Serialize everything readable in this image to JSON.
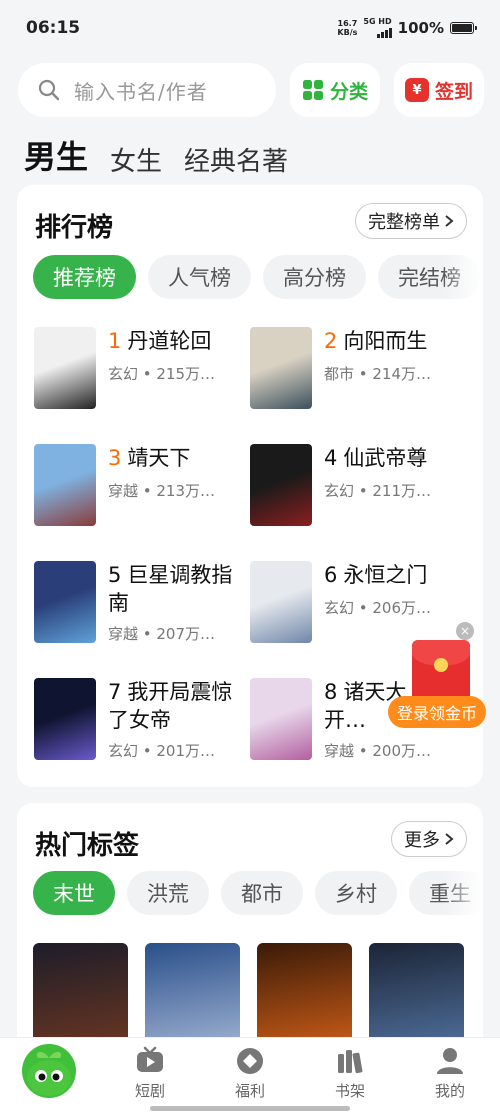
{
  "status_bar": {
    "time": "06:15",
    "net_speed": "16.7",
    "net_unit": "KB/s",
    "signal": "5G HD",
    "battery": "100%",
    "battery_level": 1.0
  },
  "search": {
    "placeholder": "输入书名/作者"
  },
  "header_buttons": {
    "category": "分类",
    "sign_in": "签到",
    "sign_icon": "¥"
  },
  "tabs": [
    {
      "label": "男生",
      "active": true
    },
    {
      "label": "女生"
    },
    {
      "label": "经典名著"
    }
  ],
  "ranking": {
    "title": "排行榜",
    "full_list": "完整榜单",
    "chips": [
      {
        "label": "推荐榜",
        "active": true
      },
      {
        "label": "人气榜"
      },
      {
        "label": "高分榜"
      },
      {
        "label": "完结榜"
      }
    ],
    "books": [
      {
        "num": "1",
        "title": "丹道轮回",
        "meta": "玄幻 • 215万…",
        "colors": [
          "#f0f0f0",
          "#222222"
        ]
      },
      {
        "num": "2",
        "title": "向阳而生",
        "meta": "都市 • 214万…",
        "colors": [
          "#d9d2c3",
          "#3b4f5c"
        ]
      },
      {
        "num": "3",
        "title": "靖天下",
        "meta": "穿越 • 213万…",
        "colors": [
          "#7fb2e0",
          "#8a3b3b"
        ]
      },
      {
        "num": "4",
        "title": "仙武帝尊",
        "meta": "玄幻 • 211万…",
        "colors": [
          "#1a1a1a",
          "#8b1f1f"
        ]
      },
      {
        "num": "5",
        "title": "巨星调教指南",
        "meta": "穿越 • 207万…",
        "colors": [
          "#2a3f7a",
          "#5fa3d9"
        ]
      },
      {
        "num": "6",
        "title": "永恒之门",
        "meta": "玄幻 • 206万…",
        "colors": [
          "#e6e9ee",
          "#6f86a8"
        ]
      },
      {
        "num": "7",
        "title": "我开局震惊了女帝",
        "meta": "玄幻 • 201万…",
        "colors": [
          "#0f1430",
          "#6a5acd"
        ]
      },
      {
        "num": "8",
        "title": "诸天大…之开…",
        "meta": "穿越 • 200万…",
        "colors": [
          "#e8d7ea",
          "#b25fa0"
        ]
      }
    ]
  },
  "hot_tags": {
    "title": "热门标签",
    "more": "更多",
    "chips": [
      {
        "label": "末世",
        "active": true
      },
      {
        "label": "洪荒"
      },
      {
        "label": "都市"
      },
      {
        "label": "乡村"
      },
      {
        "label": "重生"
      }
    ],
    "covers": [
      {
        "colors": [
          "#1d1d2a",
          "#7a3b1f"
        ]
      },
      {
        "colors": [
          "#2a4f8a",
          "#b6c6e0"
        ]
      },
      {
        "colors": [
          "#3a1a08",
          "#e86a1a"
        ]
      },
      {
        "colors": [
          "#1b2436",
          "#5a7fb0"
        ]
      }
    ]
  },
  "float_ad": {
    "label": "登录领金币",
    "close": "×"
  },
  "bottom_nav": [
    {
      "label": "短剧",
      "icon": "video-icon"
    },
    {
      "label": "福利",
      "icon": "gift-icon"
    },
    {
      "label": "书架",
      "icon": "bookshelf-icon"
    },
    {
      "label": "我的",
      "icon": "user-icon"
    }
  ]
}
